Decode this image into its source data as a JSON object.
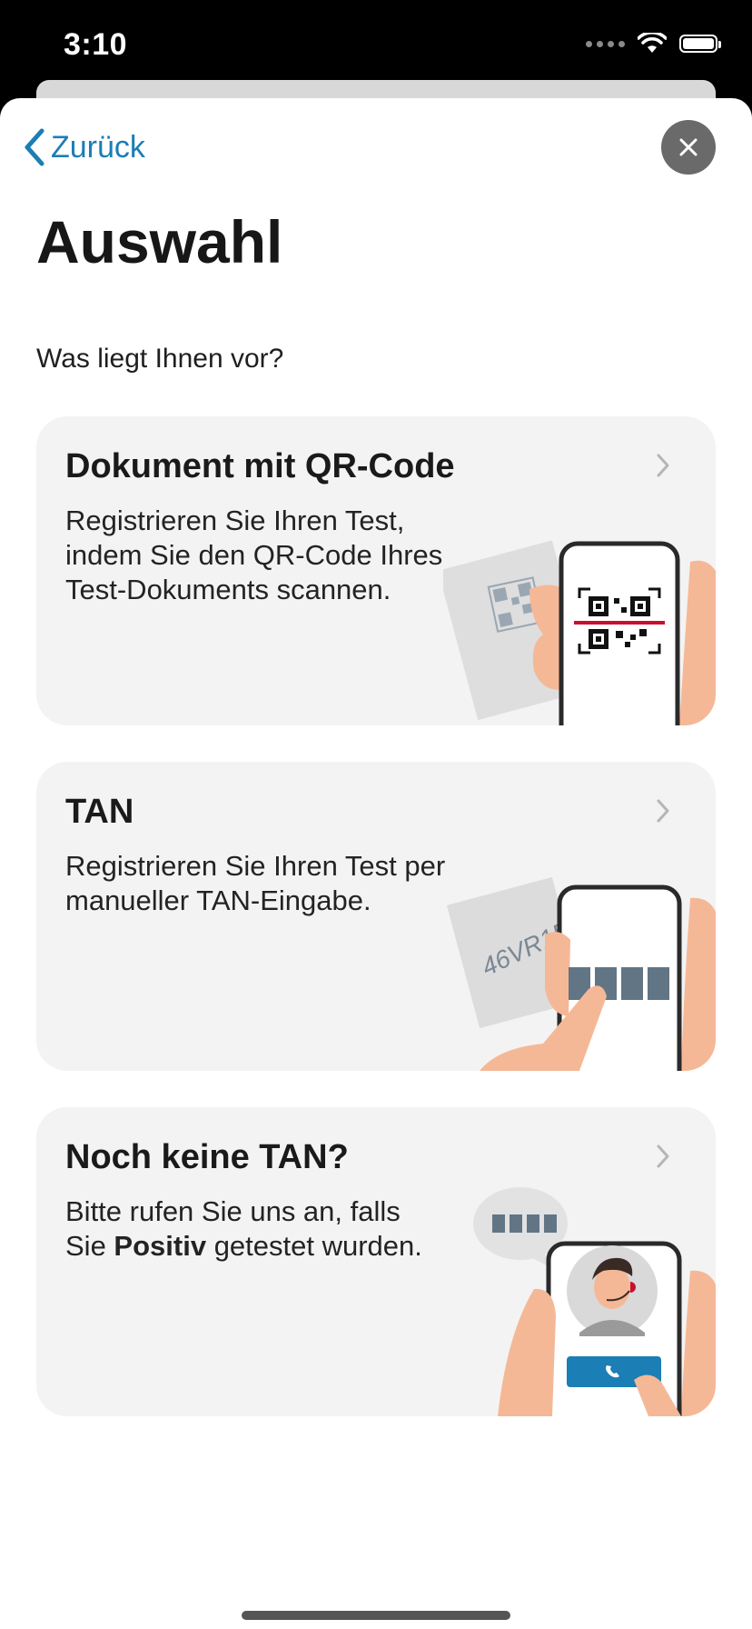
{
  "status": {
    "time": "3:10"
  },
  "nav": {
    "back_label": "Zurück",
    "close_label": "close"
  },
  "page": {
    "title": "Auswahl",
    "subtitle": "Was liegt Ihnen vor?"
  },
  "cards": [
    {
      "title": "Dokument mit QR-Code",
      "text": "Registrieren Sie Ihren Test, indem Sie den QR-Code Ihres Test-Dokuments scannen.",
      "icon": "qr-scan-illustration"
    },
    {
      "title": "TAN",
      "text": "Registrieren Sie Ihren Test per manueller TAN-Eingabe.",
      "tan_sample": "46VR1F",
      "icon": "tan-input-illustration"
    },
    {
      "title": "Noch keine TAN?",
      "text_before": "Bitte rufen Sie uns an, falls Sie ",
      "text_bold": "Positiv",
      "text_after": " getestet wurden.",
      "icon": "hotline-call-illustration"
    }
  ],
  "colors": {
    "accent": "#1b7eb5",
    "card_bg": "#f3f3f3",
    "skin": "#f5b896",
    "scan_line": "#c8102e",
    "pin_block": "#617585"
  }
}
